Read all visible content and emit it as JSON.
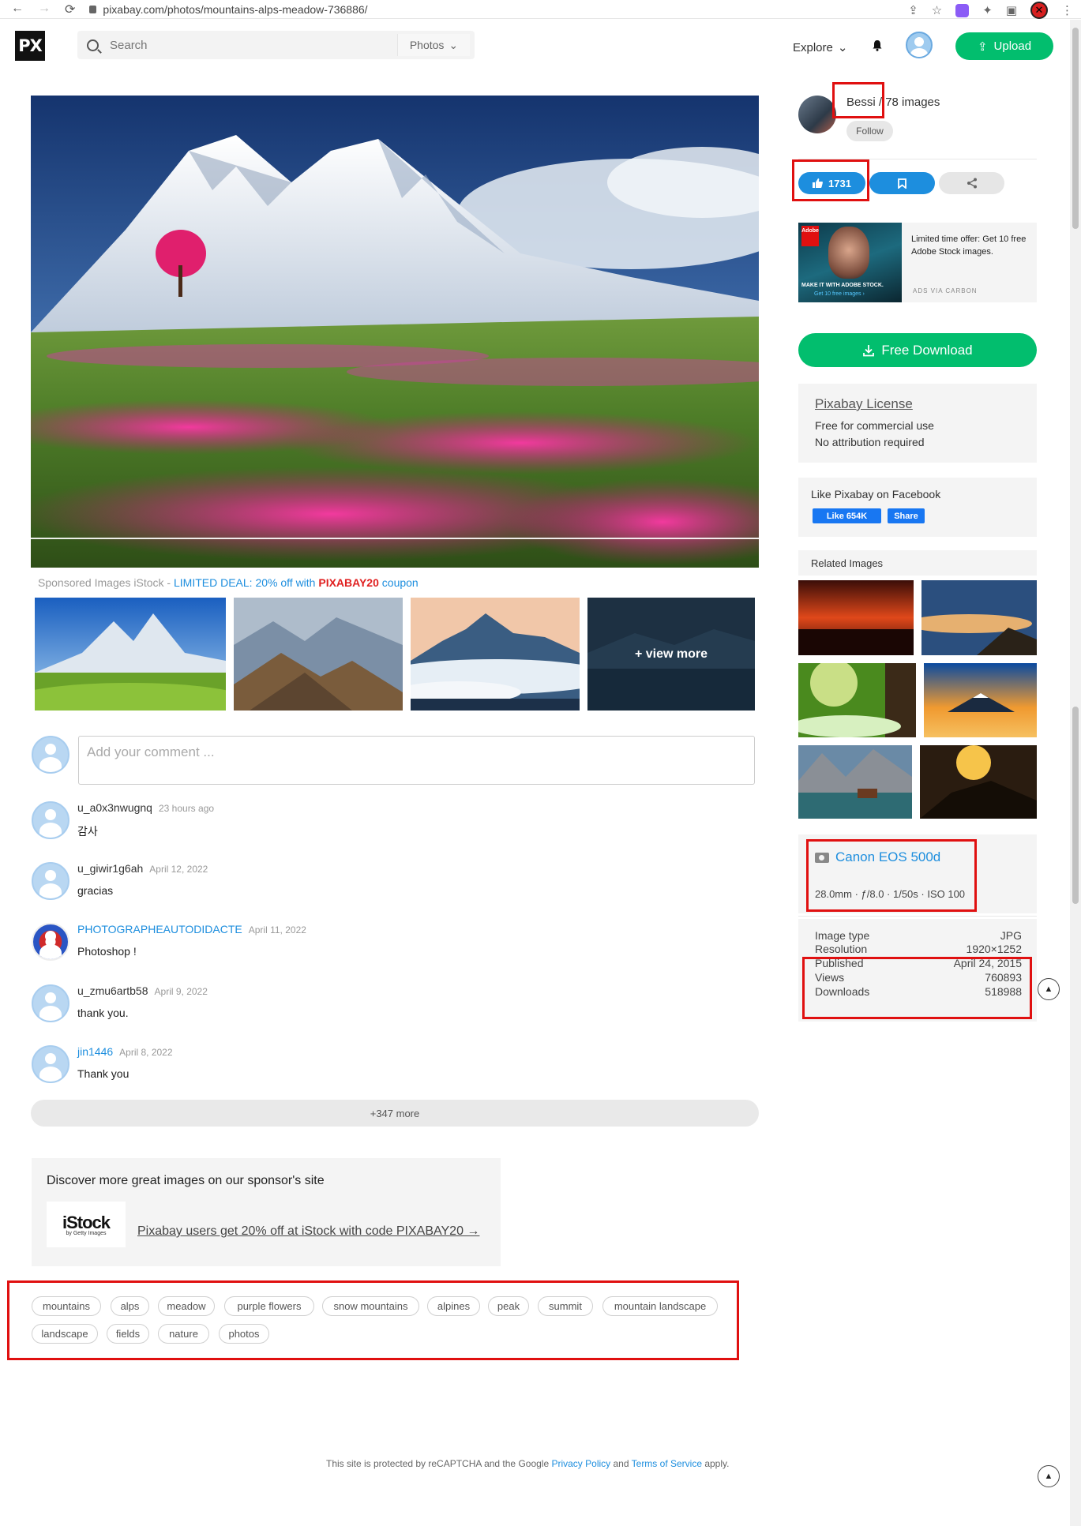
{
  "browser": {
    "url": "pixabay.com/photos/mountains-alps-meadow-736886/"
  },
  "header": {
    "logo": "PX",
    "search_placeholder": "Search",
    "search_scope": "Photos",
    "explore": "Explore",
    "upload": "Upload"
  },
  "sponsored": {
    "prefix": "Sponsored Images iStock - ",
    "deal": "LIMITED DEAL: 20% off with ",
    "code": "PIXABAY20",
    "suffix": " coupon",
    "view_more": "+ view more"
  },
  "comments": {
    "placeholder": "Add your comment ...",
    "items": [
      {
        "name": "u_a0x3nwugnq",
        "date": "23 hours ago",
        "text": "감사"
      },
      {
        "name": "u_giwir1g6ah",
        "date": "April 12, 2022",
        "text": "gracias"
      },
      {
        "name": "PHOTOGRAPHEAUTODIDACTE",
        "date": "April 11, 2022",
        "text": "Photoshop !"
      },
      {
        "name": "u_zmu6artb58",
        "date": "April 9, 2022",
        "text": "thank you."
      },
      {
        "name": "jin1446",
        "date": "April 8, 2022",
        "text": "Thank you"
      }
    ],
    "more": "+347 more"
  },
  "discover": {
    "title": "Discover more great images on our sponsor's site",
    "istock_logo": "iStock",
    "istock_sub": "by Getty Images",
    "link": "Pixabay users get 20% off at iStock with code PIXABAY20 →"
  },
  "tags": [
    "mountains",
    "alps",
    "meadow",
    "purple flowers",
    "snow mountains",
    "alpines",
    "peak",
    "summit",
    "mountain landscape",
    "landscape",
    "fields",
    "nature",
    "photos"
  ],
  "footer": {
    "pre": "This site is protected by reCAPTCHA and the Google ",
    "privacy": "Privacy Policy",
    "and": " and ",
    "terms": "Terms of Service",
    "post": " apply."
  },
  "author": {
    "name": "Bessi",
    "images": "/ 78 images",
    "follow": "Follow"
  },
  "actions": {
    "likes": "1731"
  },
  "ad": {
    "text": "Limited time offer: Get 10 free Adobe Stock images.",
    "via": "ADS VIA CARBON",
    "caption": "MAKE IT WITH ADOBE STOCK.",
    "caption2": "Get 10 free images ›",
    "adobe": "Adobe"
  },
  "download": {
    "label": "Free Download"
  },
  "license": {
    "title": "Pixabay License",
    "line1": "Free for commercial use",
    "line2": "No attribution required"
  },
  "facebook": {
    "title": "Like Pixabay on Facebook",
    "like": "Like 654K",
    "share": "Share"
  },
  "related": {
    "title": "Related Images"
  },
  "camera": {
    "name": "Canon EOS 500d",
    "settings": "28.0mm · ƒ/8.0 · 1/50s · ISO 100"
  },
  "details": [
    {
      "label": "Image type",
      "value": "JPG"
    },
    {
      "label": "Resolution",
      "value": "1920×1252"
    },
    {
      "label": "Published",
      "value": "April 24, 2015"
    },
    {
      "label": "Views",
      "value": "760893"
    },
    {
      "label": "Downloads",
      "value": "518988"
    }
  ],
  "colors": {
    "accent_green": "#02be6e",
    "accent_blue": "#1d8ede",
    "highlight_red": "#e01010"
  }
}
